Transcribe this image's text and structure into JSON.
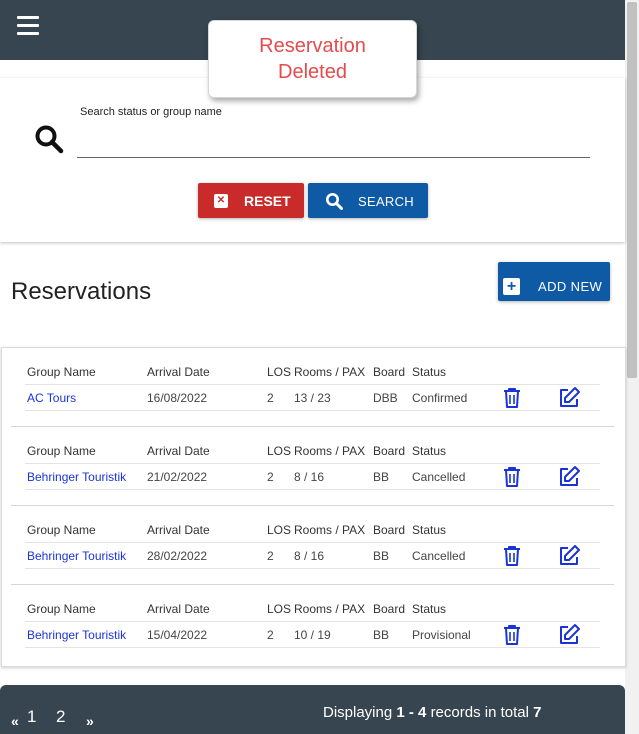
{
  "header": {
    "menu_icon": "hamburger-icon"
  },
  "toast": {
    "line1": "Reservation",
    "line2": "Deleted",
    "color": "#e54b4b"
  },
  "search": {
    "label": "Search status or group name",
    "value": "",
    "placeholder": "",
    "reset_label": "RESET",
    "search_label": "SEARCH"
  },
  "reservations": {
    "title": "Reservations",
    "add_label": "ADD NEW",
    "columns": [
      "Group Name",
      "Arrival Date",
      "LOS",
      "Rooms / PAX",
      "Board",
      "Status"
    ],
    "rows": [
      {
        "group": "AC Tours",
        "arrival": "16/08/2022",
        "los": "2",
        "rooms_pax": "13 / 23",
        "board": "DBB",
        "status": "Confirmed"
      },
      {
        "group": "Behringer Touristik",
        "arrival": "21/02/2022",
        "los": "2",
        "rooms_pax": "8 / 16",
        "board": "BB",
        "status": "Cancelled"
      },
      {
        "group": "Behringer Touristik",
        "arrival": "28/02/2022",
        "los": "2",
        "rooms_pax": "8 / 16",
        "board": "BB",
        "status": "Cancelled"
      },
      {
        "group": "Behringer Touristik",
        "arrival": "15/04/2022",
        "los": "2",
        "rooms_pax": "10 / 19",
        "board": "BB",
        "status": "Provisional"
      }
    ],
    "row_actions": [
      "trash-icon",
      "edit-icon"
    ]
  },
  "pagination": {
    "prev": "«",
    "pages": [
      "1",
      "2"
    ],
    "next": "»",
    "info_prefix": "Displaying",
    "range": "1 - 4",
    "info_mid": "records in total",
    "total": "7"
  },
  "colors": {
    "topbar": "#36454f",
    "primary": "#0e5aa5",
    "danger": "#c92a2a",
    "link": "#1a34d8"
  }
}
